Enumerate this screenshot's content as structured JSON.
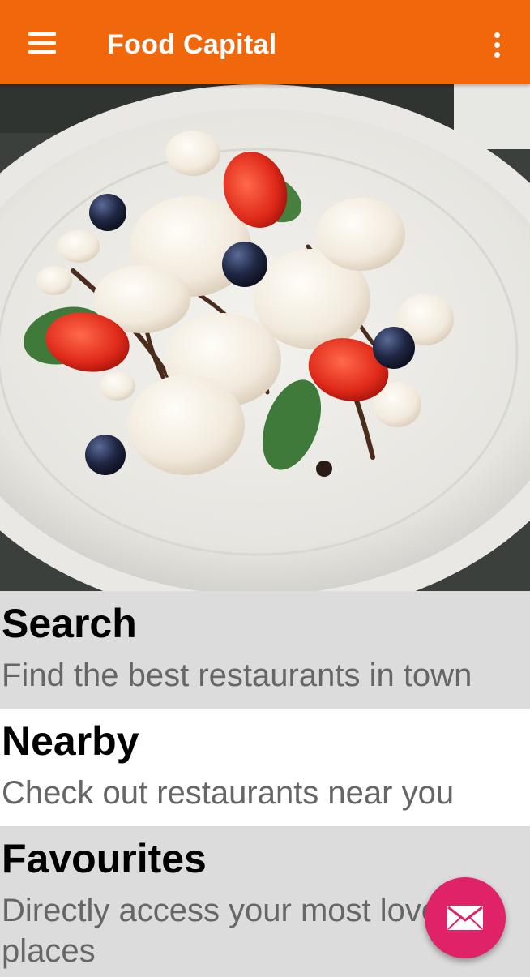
{
  "app_bar": {
    "title": "Food Capital",
    "menu_icon": "hamburger-menu-icon",
    "overflow_icon": "more-vertical-icon",
    "color": "#f0670c"
  },
  "hero": {
    "image": "meringue-dessert-plate-with-strawberries-and-blueberries",
    "carousel": {
      "pages": 3,
      "active_index": 1,
      "active_color": "#f0870c"
    }
  },
  "cards": [
    {
      "title": "Search",
      "subtitle": "Find the best restaurants in town"
    },
    {
      "title": "Nearby",
      "subtitle": "Check out restaurants near you"
    },
    {
      "title": "Favourites",
      "subtitle": "Directly access your most loved places"
    }
  ],
  "fab": {
    "icon": "mail-icon",
    "color": "#e02268"
  }
}
